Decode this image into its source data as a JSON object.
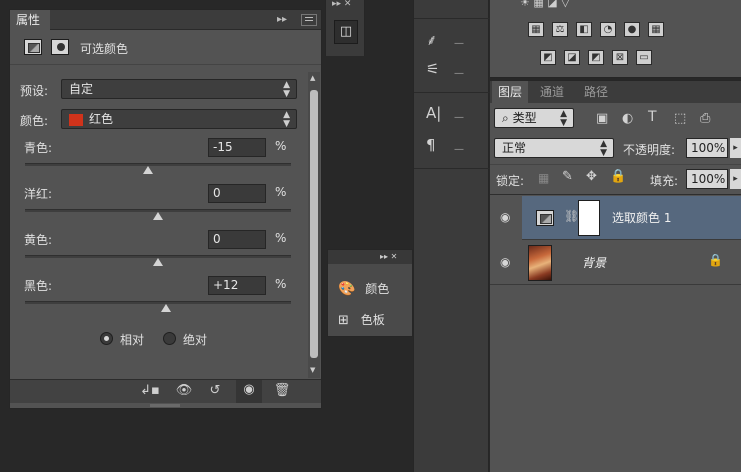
{
  "properties": {
    "tab_title": "属性",
    "panel_title": "可选颜色",
    "preset_label": "预设:",
    "preset_value": "自定",
    "color_label": "颜色:",
    "color_value": "红色",
    "color_swatch": "#d0331b",
    "sliders": [
      {
        "label": "青色:",
        "value": "-15",
        "unit": "%",
        "level": 0.4625
      },
      {
        "label": "洋红:",
        "value": "0",
        "unit": "%",
        "level": 0.5
      },
      {
        "label": "黄色:",
        "value": "0",
        "unit": "%",
        "level": 0.5
      },
      {
        "label": "黑色:",
        "value": "+12",
        "unit": "%",
        "level": 0.53
      }
    ],
    "mode_relative": "相对",
    "mode_absolute": "绝对",
    "mode_selected": "relative"
  },
  "float_panel": {
    "items": [
      {
        "icon": "palette-icon",
        "label": "颜色"
      },
      {
        "icon": "grid-icon",
        "label": "色板"
      }
    ]
  },
  "layers": {
    "tabs": [
      "图层",
      "通道",
      "路径"
    ],
    "active_tab": "图层",
    "filter_value": "类型",
    "blend_mode": "正常",
    "opacity_label": "不透明度:",
    "opacity_value": "100%",
    "lock_label": "锁定:",
    "fill_label": "填充:",
    "fill_value": "100%",
    "items": [
      {
        "name": "选取颜色 1",
        "selected": true
      },
      {
        "name": "背景",
        "selected": false
      }
    ]
  },
  "tools": {
    "type_glyph": "A|",
    "para_glyph": "¶"
  }
}
